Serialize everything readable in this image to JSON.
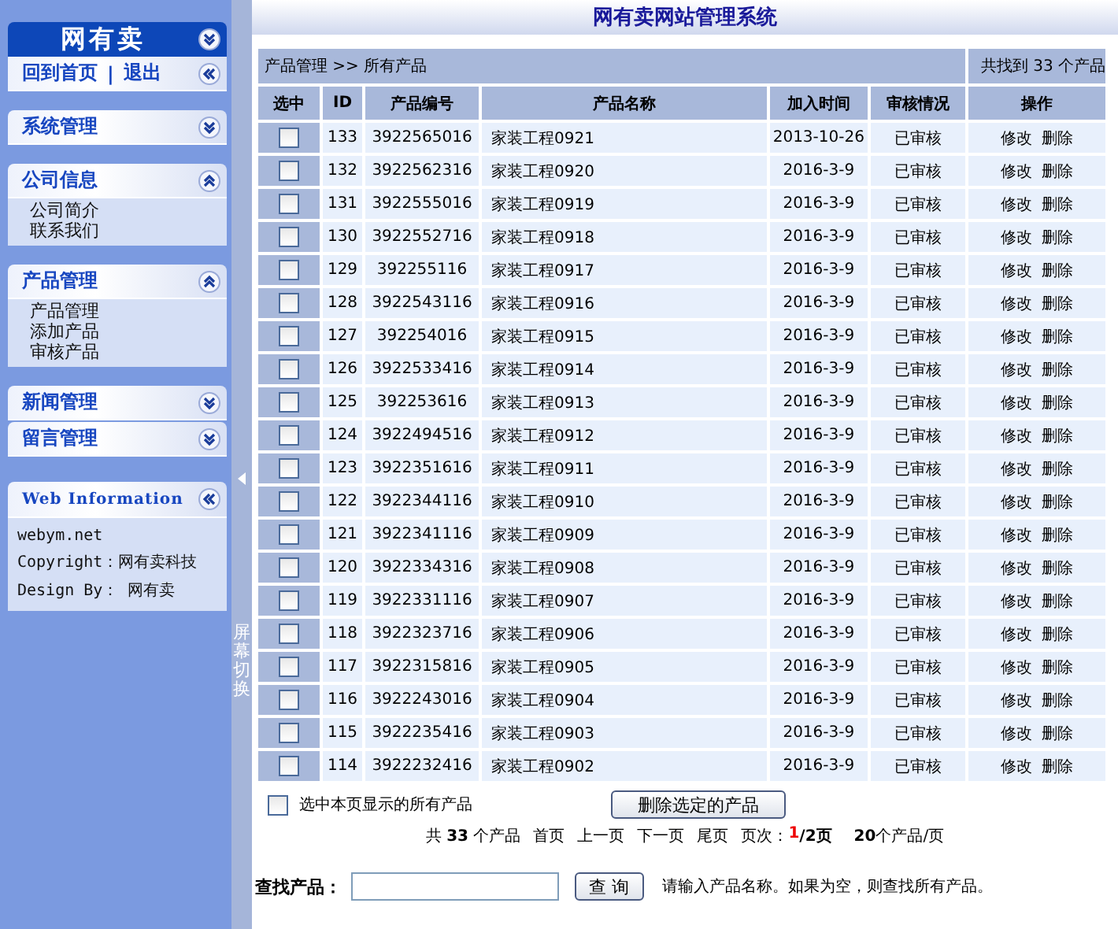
{
  "sidebar": {
    "brand": "网有卖",
    "quick_links": [
      {
        "label": "回到首页"
      },
      {
        "label": "退出"
      }
    ],
    "link_separator": "|",
    "sections": [
      {
        "title": "系统管理",
        "expanded": false
      },
      {
        "title": "公司信息",
        "expanded": true,
        "items": [
          "公司简介",
          "联系我们"
        ]
      },
      {
        "title": "产品管理",
        "expanded": true,
        "items": [
          "产品管理",
          "添加产品",
          "审核产品"
        ]
      },
      {
        "title": "新闻管理",
        "expanded": false
      },
      {
        "title": "留言管理",
        "expanded": false
      }
    ],
    "info": {
      "title": "Web Information",
      "lines": [
        "webym.net",
        "Copyright：网有卖科技",
        "Design By： 网有卖"
      ]
    }
  },
  "splitter": {
    "label": "屏幕切换"
  },
  "window": {
    "title": "网有卖网站管理系统"
  },
  "breadcrumb": "产品管理 >> 所有产品",
  "found": "共找到 33 个产品",
  "table": {
    "columns": [
      "选中",
      "ID",
      "产品编号",
      "产品名称",
      "加入时间",
      "审核情况",
      "操作"
    ],
    "rows": [
      {
        "checked": false,
        "id": "133",
        "code": "3922565016",
        "name": "家装工程0921",
        "date": "2013-10-26",
        "status": "已审核",
        "actions": [
          "修改",
          "删除"
        ]
      },
      {
        "checked": false,
        "id": "132",
        "code": "3922562316",
        "name": "家装工程0920",
        "date": "2016-3-9",
        "status": "已审核",
        "actions": [
          "修改",
          "删除"
        ]
      },
      {
        "checked": false,
        "id": "131",
        "code": "3922555016",
        "name": "家装工程0919",
        "date": "2016-3-9",
        "status": "已审核",
        "actions": [
          "修改",
          "删除"
        ]
      },
      {
        "checked": false,
        "id": "130",
        "code": "3922552716",
        "name": "家装工程0918",
        "date": "2016-3-9",
        "status": "已审核",
        "actions": [
          "修改",
          "删除"
        ]
      },
      {
        "checked": false,
        "id": "129",
        "code": "392255116",
        "name": "家装工程0917",
        "date": "2016-3-9",
        "status": "已审核",
        "actions": [
          "修改",
          "删除"
        ]
      },
      {
        "checked": false,
        "id": "128",
        "code": "3922543116",
        "name": "家装工程0916",
        "date": "2016-3-9",
        "status": "已审核",
        "actions": [
          "修改",
          "删除"
        ]
      },
      {
        "checked": false,
        "id": "127",
        "code": "392254016",
        "name": "家装工程0915",
        "date": "2016-3-9",
        "status": "已审核",
        "actions": [
          "修改",
          "删除"
        ]
      },
      {
        "checked": false,
        "id": "126",
        "code": "3922533416",
        "name": "家装工程0914",
        "date": "2016-3-9",
        "status": "已审核",
        "actions": [
          "修改",
          "删除"
        ]
      },
      {
        "checked": false,
        "id": "125",
        "code": "392253616",
        "name": "家装工程0913",
        "date": "2016-3-9",
        "status": "已审核",
        "actions": [
          "修改",
          "删除"
        ]
      },
      {
        "checked": false,
        "id": "124",
        "code": "3922494516",
        "name": "家装工程0912",
        "date": "2016-3-9",
        "status": "已审核",
        "actions": [
          "修改",
          "删除"
        ]
      },
      {
        "checked": false,
        "id": "123",
        "code": "3922351616",
        "name": "家装工程0911",
        "date": "2016-3-9",
        "status": "已审核",
        "actions": [
          "修改",
          "删除"
        ]
      },
      {
        "checked": false,
        "id": "122",
        "code": "3922344116",
        "name": "家装工程0910",
        "date": "2016-3-9",
        "status": "已审核",
        "actions": [
          "修改",
          "删除"
        ]
      },
      {
        "checked": false,
        "id": "121",
        "code": "3922341116",
        "name": "家装工程0909",
        "date": "2016-3-9",
        "status": "已审核",
        "actions": [
          "修改",
          "删除"
        ]
      },
      {
        "checked": false,
        "id": "120",
        "code": "3922334316",
        "name": "家装工程0908",
        "date": "2016-3-9",
        "status": "已审核",
        "actions": [
          "修改",
          "删除"
        ]
      },
      {
        "checked": false,
        "id": "119",
        "code": "3922331116",
        "name": "家装工程0907",
        "date": "2016-3-9",
        "status": "已审核",
        "actions": [
          "修改",
          "删除"
        ]
      },
      {
        "checked": false,
        "id": "118",
        "code": "3922323716",
        "name": "家装工程0906",
        "date": "2016-3-9",
        "status": "已审核",
        "actions": [
          "修改",
          "删除"
        ]
      },
      {
        "checked": false,
        "id": "117",
        "code": "3922315816",
        "name": "家装工程0905",
        "date": "2016-3-9",
        "status": "已审核",
        "actions": [
          "修改",
          "删除"
        ]
      },
      {
        "checked": false,
        "id": "116",
        "code": "3922243016",
        "name": "家装工程0904",
        "date": "2016-3-9",
        "status": "已审核",
        "actions": [
          "修改",
          "删除"
        ]
      },
      {
        "checked": false,
        "id": "115",
        "code": "3922235416",
        "name": "家装工程0903",
        "date": "2016-3-9",
        "status": "已审核",
        "actions": [
          "修改",
          "删除"
        ]
      },
      {
        "checked": false,
        "id": "114",
        "code": "3922232416",
        "name": "家装工程0902",
        "date": "2016-3-9",
        "status": "已审核",
        "actions": [
          "修改",
          "删除"
        ]
      }
    ]
  },
  "select_all": {
    "label": "选中本页显示的所有产品",
    "checked": false
  },
  "delete_button": "删除选定的产品",
  "pagination": {
    "total": "共 **33** 个产品",
    "links": [
      "首页",
      "上一页",
      "下一页",
      "尾页"
    ],
    "page_label": "页次：",
    "current": "1",
    "pages": "/2页",
    "per_page": "**20**个产品/页"
  },
  "search": {
    "label": "查找产品：",
    "button": "查 询",
    "hint": "请输入产品名称。如果为空，则查找所有产品。"
  }
}
